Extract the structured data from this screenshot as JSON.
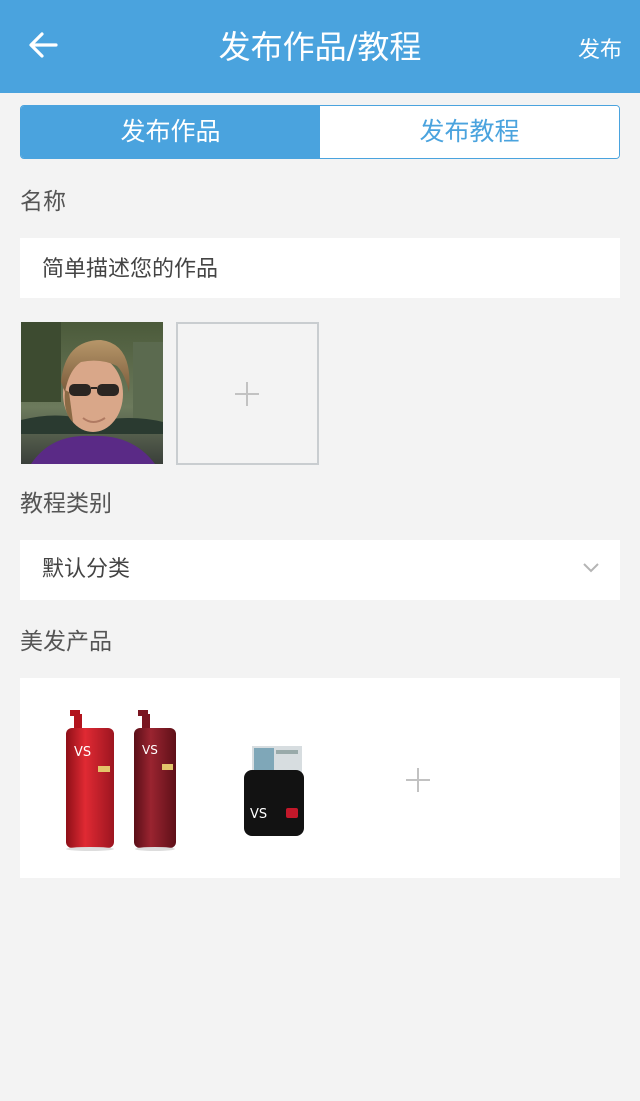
{
  "header": {
    "title": "发布作品/教程",
    "publish_label": "发布",
    "back_icon": "arrow-left-icon"
  },
  "tabs": [
    {
      "label": "发布作品",
      "active": true
    },
    {
      "label": "发布教程",
      "active": false
    }
  ],
  "name_section": {
    "label": "名称",
    "placeholder": "简单描述您的作品"
  },
  "photos": {
    "items": [
      {
        "alt": "portrait photo of man with sunglasses"
      }
    ],
    "add_icon": "plus-icon"
  },
  "category": {
    "label": "教程类别",
    "value": "默认分类",
    "icon": "chevron-down-icon"
  },
  "products": {
    "label": "美发产品",
    "items": [
      {
        "name": "VS shampoo bottles"
      },
      {
        "name": "VS hair wax jar"
      }
    ],
    "add_icon": "plus-icon"
  },
  "colors": {
    "accent": "#4aa3de",
    "background": "#f3f3f3",
    "card": "#ffffff"
  }
}
